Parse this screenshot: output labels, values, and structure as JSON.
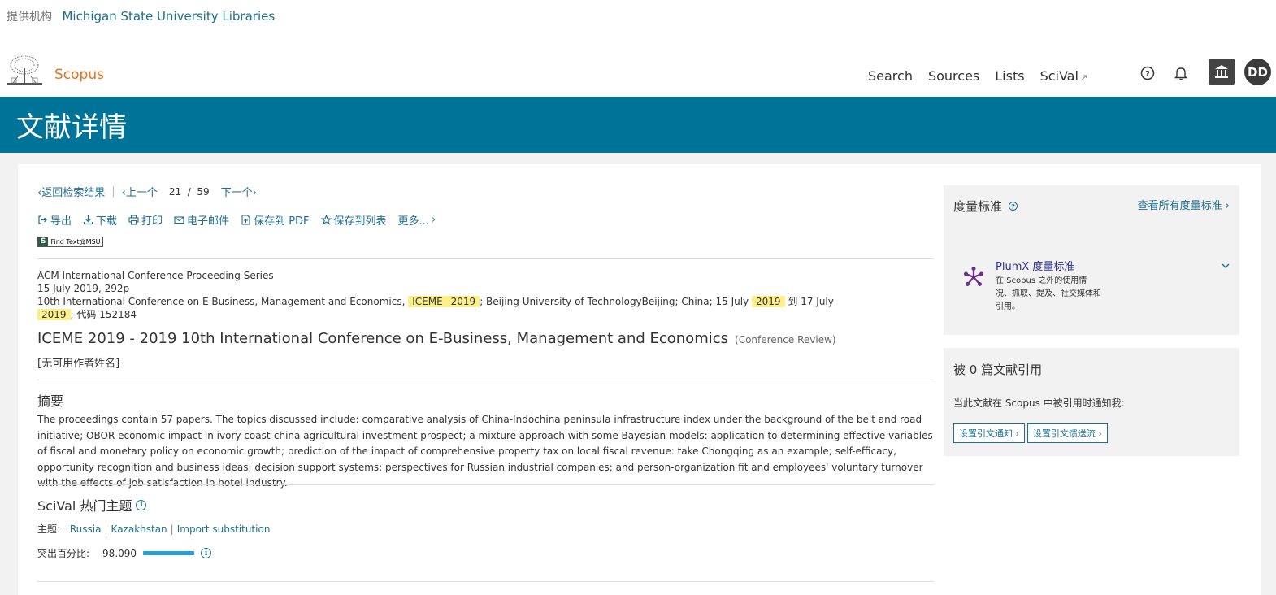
{
  "institution": {
    "label": "提供机构",
    "name": "Michigan State University Libraries"
  },
  "header": {
    "brand": "Scopus",
    "nav": [
      "Search",
      "Sources",
      "Lists",
      "SciVal"
    ],
    "avatar": "DD"
  },
  "page": {
    "title": "文献详情"
  },
  "doc_nav": {
    "back": "返回检索结果",
    "prev": "上一个",
    "current": "21",
    "total": "59",
    "next": "下一个"
  },
  "actions": {
    "export": "导出",
    "download": "下载",
    "print": "打印",
    "email": "电子邮件",
    "save_pdf": "保存到 PDF",
    "save_list": "保存到列表",
    "more": "更多..."
  },
  "findtext": {
    "badge": "S",
    "label": "Find Text@MSU"
  },
  "meta": {
    "series": "ACM International Conference Proceeding Series",
    "date_pages": "15 July 2019, 292p",
    "conf_pre": "10th International Conference on E-Business, Management and Economics,",
    "conf_abbr": "ICEME",
    "conf_year": "2019",
    "conf_mid": "; Beijing University of TechnologyBeijing; China; 15 July",
    "conf_year2": "2019",
    "conf_to": "到 17 July",
    "conf_year3": "2019",
    "conf_code": "; 代码 152184"
  },
  "document": {
    "title": "ICEME 2019 - 2019 10th International Conference on E-Business, Management and Economics",
    "type": "(Conference Review)",
    "authors": "[无可用作者姓名]"
  },
  "abstract": {
    "heading": "摘要",
    "text": "The proceedings contain 57 papers. The topics discussed include: comparative analysis of China-Indochina peninsula infrastructure index under the background of the belt and road initiative; OBOR economic impact in ivory coast-china agricultural investment prospect; a mixture approach with some Bayesian models: application to determining effective variables of fiscal and monetary policy on economic growth; prediction of the impact of comprehensive property tax on local fiscal revenue: take Chongqing as an example; self-efficacy, opportunity recognition and business ideas; decision support systems: perspectives for Russian industrial companies; and person-organization fit and employees' voluntary turnover with the effects of job satisfaction in hotel industry."
  },
  "scival": {
    "heading": "SciVal 热门主题",
    "topic_label": "主题:",
    "topics": [
      "Russia",
      "Kazakhstan",
      "Import substitution"
    ],
    "percentile_label": "突出百分比:",
    "percentile_value": "98.090",
    "percentile_fraction": 0.98
  },
  "metrics_panel": {
    "title": "度量标准",
    "view_all": "查看所有度量标准",
    "plumx_title": "PlumX 度量标准",
    "plumx_desc": "在 Scopus 之外的使用情况、抓取、提及、社交媒体和引用。"
  },
  "cited_panel": {
    "title": "被 0 篇文献引用",
    "note": "当此文献在 Scopus 中被引用时通知我:",
    "btn_alert": "设置引文通知",
    "btn_feed": "设置引文馈送流"
  },
  "colors": {
    "band": "#007398",
    "brand": "#e9711c",
    "link": "#1f6f8f",
    "highlight": "#fdf08a",
    "bar": "#2a9fd6"
  }
}
